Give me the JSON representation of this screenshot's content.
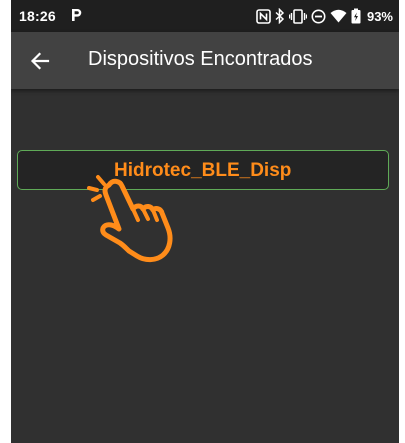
{
  "status_bar": {
    "time": "18:26",
    "battery": "93%",
    "icons": [
      "parking-icon",
      "nfc-icon",
      "bluetooth-icon",
      "vibrate-icon",
      "do-not-disturb-icon",
      "wifi-icon",
      "battery-icon"
    ]
  },
  "app_bar": {
    "title": "Dispositivos Encontrados",
    "back_icon": "arrow-back-icon"
  },
  "devices": [
    {
      "name": "Hidrotec_BLE_Disp"
    }
  ],
  "colors": {
    "background": "#303030",
    "app_bar": "#424242",
    "status_bar": "#1f1f1f",
    "item_border": "#5faa57",
    "accent": "#ff8c1a"
  },
  "overlay": {
    "icon": "tap-hand-icon"
  }
}
